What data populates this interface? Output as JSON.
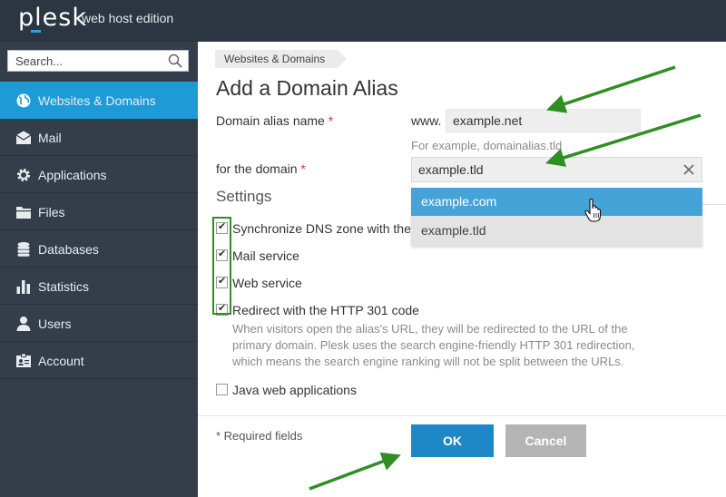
{
  "header": {
    "logo": "plesk",
    "edition": "web host edition"
  },
  "sidebar": {
    "search_placeholder": "Search...",
    "items": [
      {
        "label": "Websites & Domains",
        "icon": "globe-icon",
        "active": true
      },
      {
        "label": "Mail",
        "icon": "envelope-icon"
      },
      {
        "label": "Applications",
        "icon": "gear-icon"
      },
      {
        "label": "Files",
        "icon": "folder-icon"
      },
      {
        "label": "Databases",
        "icon": "database-icon"
      },
      {
        "label": "Statistics",
        "icon": "bar-chart-icon"
      },
      {
        "label": "Users",
        "icon": "user-icon"
      },
      {
        "label": "Account",
        "icon": "id-card-icon"
      }
    ]
  },
  "main": {
    "breadcrumb": "Websites & Domains",
    "title": "Add a Domain Alias",
    "alias_label": "Domain alias name",
    "required_mark": "*",
    "www_prefix": "www.",
    "alias_value": "example.net",
    "alias_hint": "For example, domainalias.tld",
    "domain_label": "for the domain",
    "domain_value": "example.tld",
    "domain_options": [
      "example.com",
      "example.tld"
    ],
    "settings_heading": "Settings",
    "checkboxes": [
      {
        "label": "Synchronize DNS zone with the p",
        "checked": true
      },
      {
        "label": "Mail service",
        "checked": true
      },
      {
        "label": "Web service",
        "checked": true
      },
      {
        "label": "Redirect with the HTTP 301 code",
        "checked": true
      },
      {
        "label": "Java web applications",
        "checked": false
      }
    ],
    "redirect_desc_1": "When visitors open the alias's URL, they will be redirected to the URL of the",
    "redirect_desc_2": "primary domain. Plesk uses the search engine-friendly HTTP 301 redirection,",
    "redirect_desc_3": "which means the search engine ranking will not be split between the URLs.",
    "required_note": "* Required fields",
    "ok_label": "OK",
    "cancel_label": "Cancel"
  },
  "colors": {
    "header_bg": "#2b3642",
    "sidebar_bg": "#333e4a",
    "active_blue": "#1d9bd7",
    "ok_blue": "#1e88c7",
    "annotation_green": "#2e8f22"
  }
}
